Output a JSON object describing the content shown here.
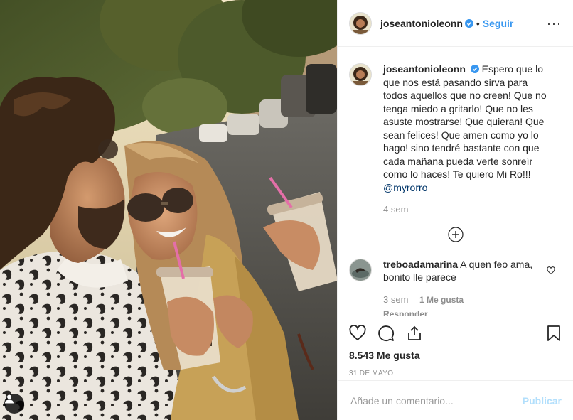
{
  "post": {
    "author": {
      "username": "joseantonioleonn",
      "verified": true,
      "avatar_icon": "profile-avatar-icon"
    },
    "header": {
      "separator": "•",
      "follow_label": "Seguir",
      "more_label": "···"
    },
    "caption": {
      "username": "joseantonioleonn",
      "text": "Espero que lo que nos está pasando sirva para todos aquellos que no creen! Que no tenga miedo a gritarlo! Que no les asuste mostrarse! Que quieran! Que sean felices! Que amen como yo lo hago! sino tendré bastante con que cada mañana pueda verte sonreír como lo haces! Te quiero Mi Ro!!!",
      "mention": "@myrorro",
      "time": "4 sem"
    },
    "comments": [
      {
        "username": "treboadamarina",
        "text": "A quen feo ama, bonito lle parece",
        "time": "3 sem",
        "likes": "1 Me gusta",
        "reply_label": "Responder"
      }
    ],
    "likes_count": "8.543 Me gusta",
    "date": "31 DE MAYO",
    "add_comment": {
      "placeholder": "Añade un comentario...",
      "publish_label": "Publicar"
    }
  },
  "colors": {
    "link_blue": "#3897f0",
    "publish_disabled": "#b2dffc",
    "secondary_text": "#8e8e8e",
    "border": "#efefef"
  }
}
